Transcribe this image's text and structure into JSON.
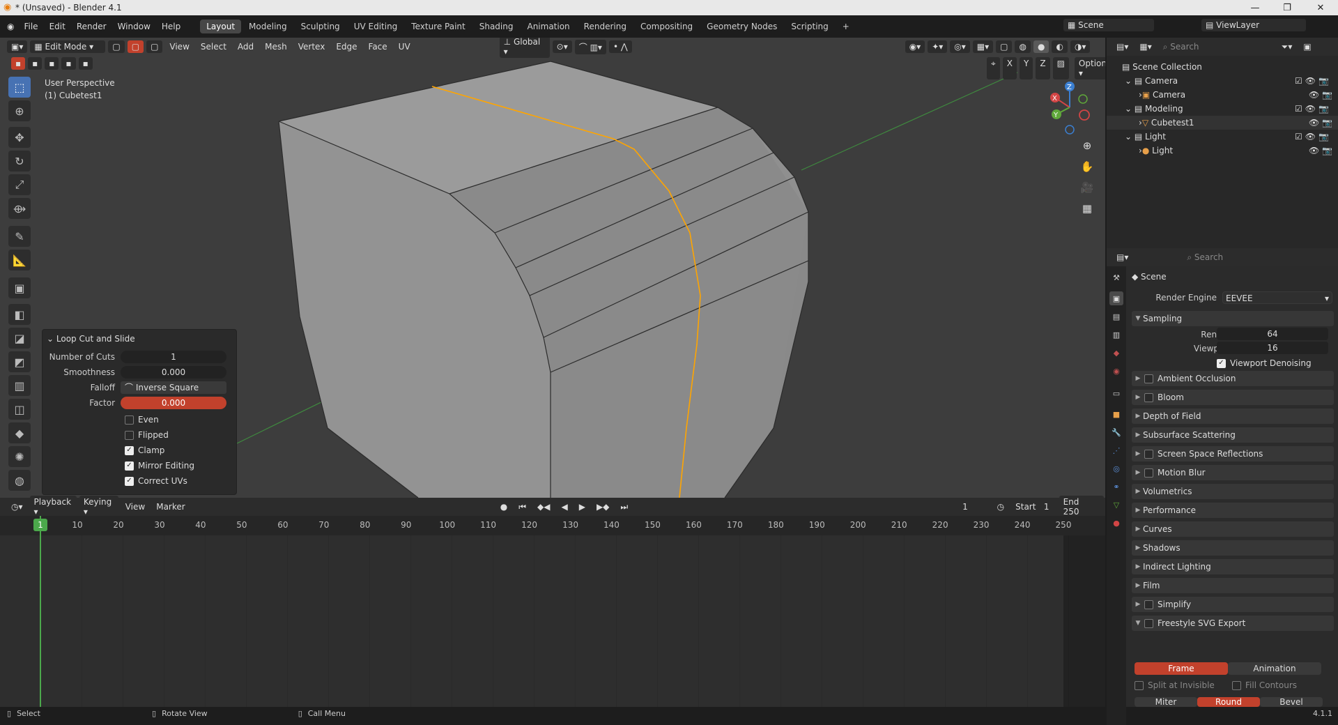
{
  "window": {
    "title": "* (Unsaved) - Blender 4.1"
  },
  "menubar": {
    "items": [
      "File",
      "Edit",
      "Render",
      "Window",
      "Help"
    ]
  },
  "workspaces": {
    "tabs": [
      "Layout",
      "Modeling",
      "Sculpting",
      "UV Editing",
      "Texture Paint",
      "Shading",
      "Animation",
      "Rendering",
      "Compositing",
      "Geometry Nodes",
      "Scripting"
    ],
    "active": "Layout",
    "add_icon": "+"
  },
  "topright": {
    "scene": "Scene",
    "view_layer": "ViewLayer"
  },
  "viewport": {
    "mode": "Edit Mode",
    "menus": [
      "View",
      "Select",
      "Add",
      "Mesh",
      "Vertex",
      "Edge",
      "Face",
      "UV"
    ],
    "orientation": "Global",
    "options": "Options",
    "axis_labels": [
      "X",
      "Y",
      "Z"
    ],
    "info_line1": "User Perspective",
    "info_line2": "(1) Cubetest1",
    "gizmo": {
      "x": "X",
      "y": "Y",
      "z": "Z"
    }
  },
  "redo_panel": {
    "title": "Loop Cut and Slide",
    "number_of_cuts_label": "Number of Cuts",
    "number_of_cuts": "1",
    "smoothness_label": "Smoothness",
    "smoothness": "0.000",
    "falloff_label": "Falloff",
    "falloff": "Inverse Square",
    "factor_label": "Factor",
    "factor": "0.000",
    "checkboxes": [
      {
        "label": "Even",
        "checked": false
      },
      {
        "label": "Flipped",
        "checked": false
      },
      {
        "label": "Clamp",
        "checked": true
      },
      {
        "label": "Mirror Editing",
        "checked": true
      },
      {
        "label": "Correct UVs",
        "checked": true
      }
    ]
  },
  "timeline": {
    "menus": [
      "Playback",
      "Keying",
      "View",
      "Marker"
    ],
    "current_frame": "1",
    "start_label": "Start",
    "start": "1",
    "end_label": "End",
    "end": "250",
    "ruler": [
      "1",
      "10",
      "20",
      "30",
      "40",
      "50",
      "60",
      "70",
      "80",
      "90",
      "100",
      "110",
      "120",
      "130",
      "140",
      "150",
      "160",
      "170",
      "180",
      "190",
      "200",
      "210",
      "220",
      "230",
      "240",
      "250"
    ]
  },
  "statusbar": {
    "select": "Select",
    "rotate": "Rotate View",
    "call_menu": "Call Menu",
    "version": "4.1.1"
  },
  "outliner": {
    "search_placeholder": "Search",
    "root": "Scene Collection",
    "rows": [
      {
        "name": "Camera",
        "kind": "collection"
      },
      {
        "name": "Camera",
        "kind": "object"
      },
      {
        "name": "Modeling",
        "kind": "collection"
      },
      {
        "name": "Cubetest1",
        "kind": "object"
      },
      {
        "name": "Light",
        "kind": "collection"
      },
      {
        "name": "Light",
        "kind": "object"
      }
    ]
  },
  "properties": {
    "search_placeholder": "Search",
    "context": "Scene",
    "render_engine_label": "Render Engine",
    "render_engine": "EEVEE",
    "sampling": {
      "title": "Sampling",
      "render_label": "Render",
      "render": "64",
      "viewport_label": "Viewport",
      "viewport": "16",
      "denoise_label": "Viewport Denoising"
    },
    "panels": [
      "Ambient Occlusion",
      "Bloom",
      "Depth of Field",
      "Subsurface Scattering",
      "Screen Space Reflections",
      "Motion Blur",
      "Volumetrics",
      "Performance",
      "Curves",
      "Shadows",
      "Indirect Lighting",
      "Film",
      "Simplify",
      "Freestyle SVG Export"
    ],
    "freestyle": {
      "frame": "Frame",
      "animation": "Animation",
      "split": "Split at Invisible",
      "fill": "Fill Contours",
      "miter": "Miter",
      "round": "Round",
      "bevel": "Bevel"
    }
  },
  "colors": {
    "accent": "#4772b3",
    "active_red": "#c2412c",
    "edge_select": "#ffa500"
  }
}
